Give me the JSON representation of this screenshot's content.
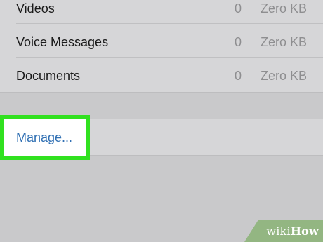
{
  "list": {
    "rows": [
      {
        "label": "Videos",
        "count": "0",
        "size": "Zero KB"
      },
      {
        "label": "Voice Messages",
        "count": "0",
        "size": "Zero KB"
      },
      {
        "label": "Documents",
        "count": "0",
        "size": "Zero KB"
      }
    ]
  },
  "manage": {
    "label": "Manage...",
    "link_color": "#2f6fb3",
    "highlight_color": "#31e11f"
  },
  "watermark": {
    "wiki": "wiki",
    "how": "How"
  }
}
